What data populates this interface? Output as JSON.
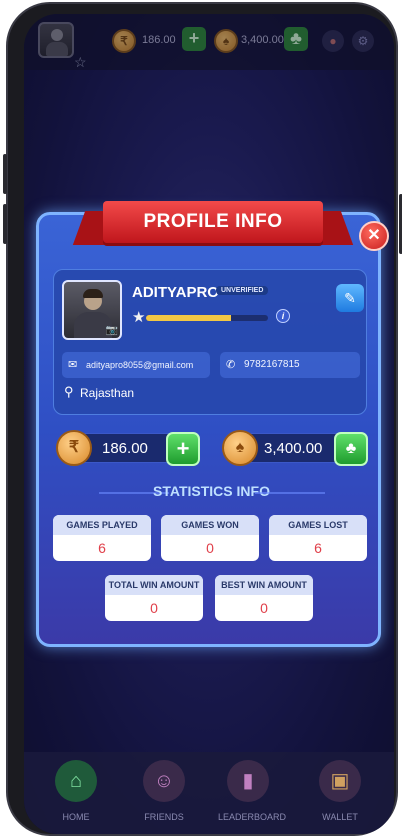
{
  "topbar": {
    "coins": "186.00",
    "chips": "3,400.00"
  },
  "profile": {
    "title": "PROFILE INFO",
    "username": "ADITYAPRO",
    "status_badge": "UNVERIFIED",
    "level_progress": 0.7,
    "email": "adityapro8055@gmail.com",
    "phone": "9782167815",
    "location": "Rajasthan"
  },
  "balances": {
    "cash": "186.00",
    "chips": "3,400.00"
  },
  "stats": {
    "title": "STATISTICS INFO",
    "items": [
      {
        "label": "GAMES PLAYED",
        "value": "6"
      },
      {
        "label": "GAMES WON",
        "value": "0"
      },
      {
        "label": "GAMES LOST",
        "value": "6"
      },
      {
        "label": "TOTAL WIN AMOUNT",
        "value": "0"
      },
      {
        "label": "BEST WIN AMOUNT",
        "value": "0"
      }
    ]
  },
  "nav": {
    "items": [
      {
        "label": "HOME"
      },
      {
        "label": "FRIENDS"
      },
      {
        "label": "LEADERBOARD"
      },
      {
        "label": "WALLET"
      }
    ]
  },
  "icons": {
    "close": "close-icon",
    "edit": "pencil-icon",
    "email": "mail-icon",
    "phone": "phone-icon",
    "location": "location-pin-icon"
  },
  "colors": {
    "ribbon": "#e23030",
    "modal": "#3a64d6",
    "plus_button": "#2ea83a",
    "stat_value": "#e0404a"
  }
}
